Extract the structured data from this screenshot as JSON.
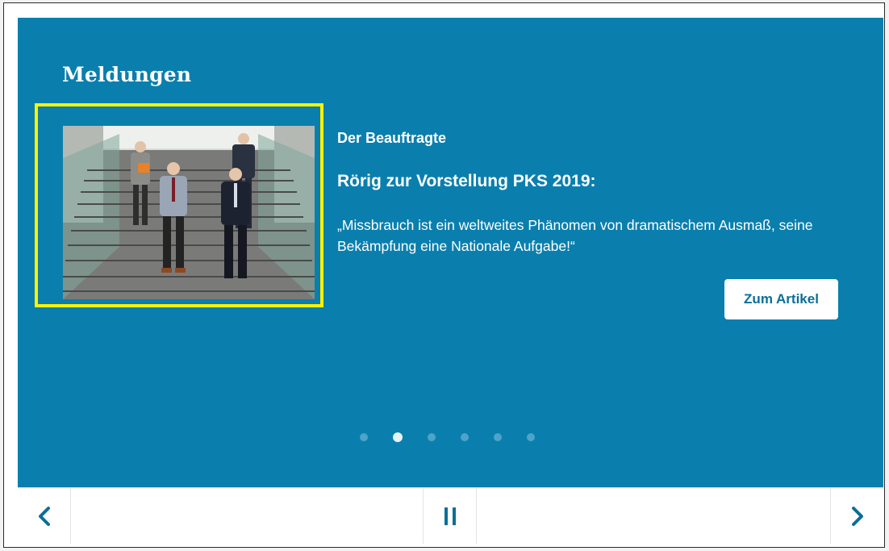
{
  "slider": {
    "heading": "Meldungen",
    "category": "Der Beauftragte",
    "title": "Rörig zur Vorstellung PKS 2019:",
    "teaser": "„Missbrauch ist ein weltweites Phänomen von dramatischem Ausmaß, seine Bekämpfung eine Nationale Aufgabe!“",
    "cta_label": "Zum Artikel",
    "dots_total": 6,
    "active_dot": 2
  },
  "controls": {
    "prev_icon": "chevron-left-icon",
    "pause_icon": "pause-icon",
    "next_icon": "chevron-right-icon"
  },
  "colors": {
    "panel_bg": "#0a7fae",
    "highlight": "#fff200",
    "button_text": "#0a6f98"
  }
}
